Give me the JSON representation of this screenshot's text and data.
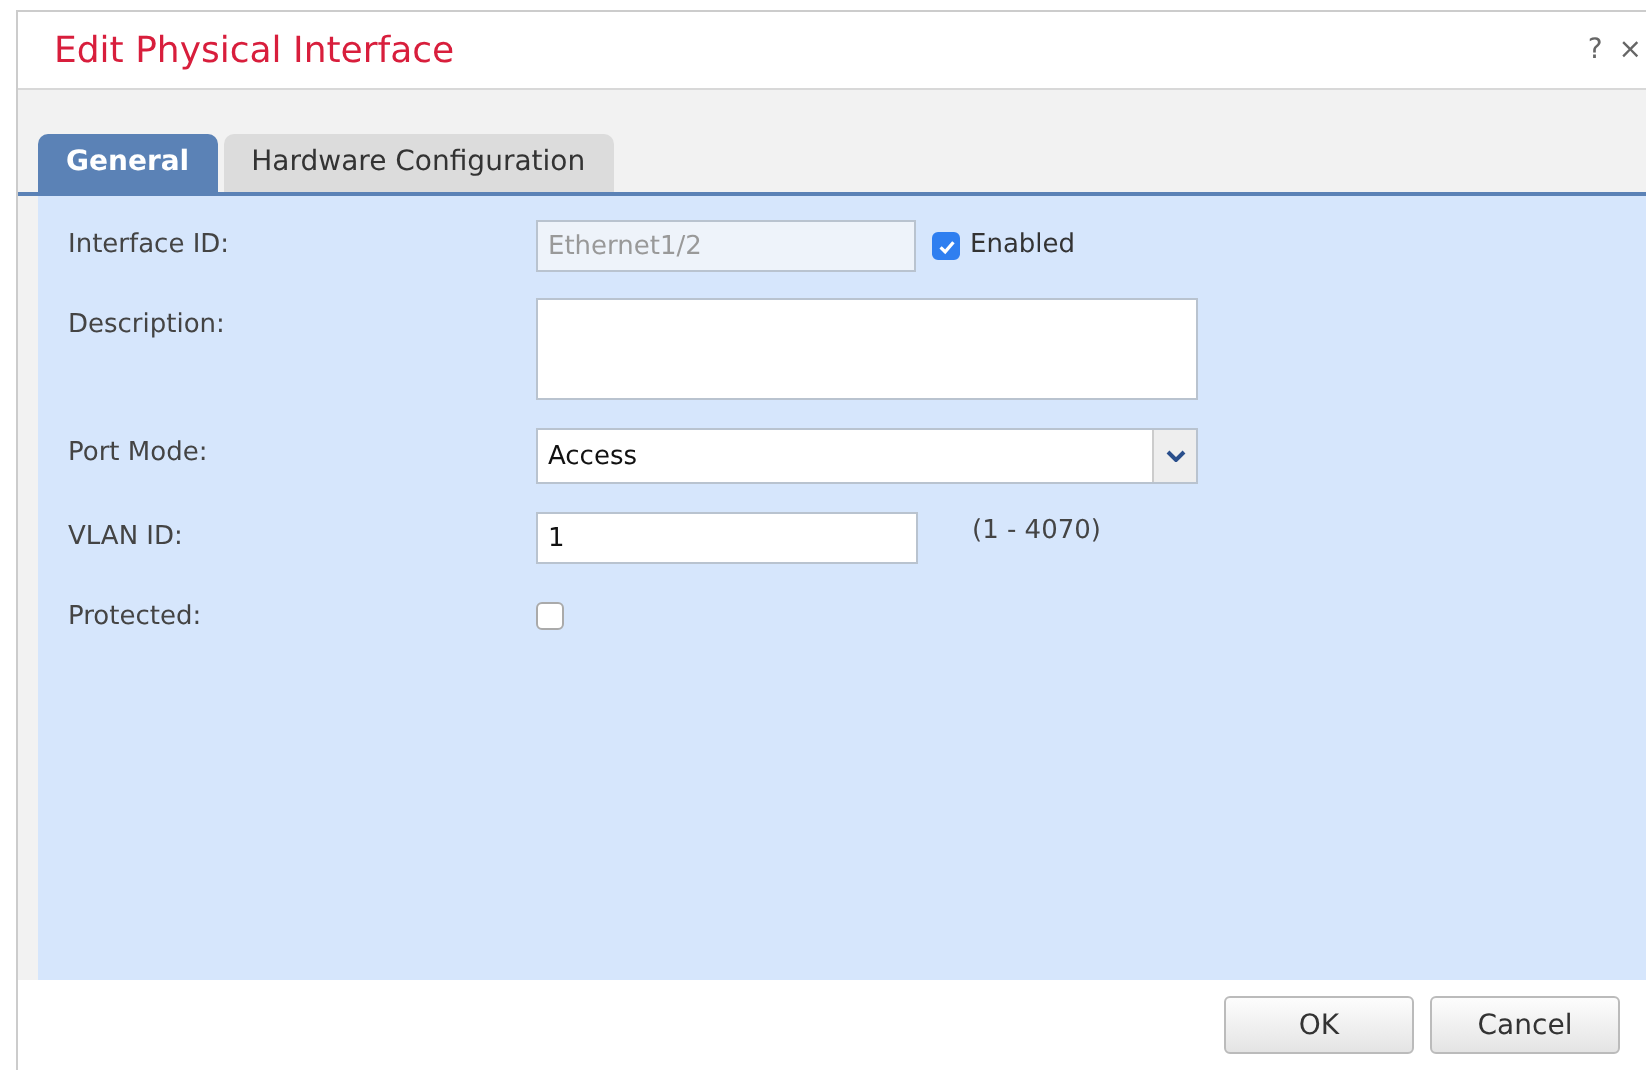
{
  "window": {
    "title": "Edit Physical Interface",
    "help": "?",
    "close": "×"
  },
  "tabs": [
    {
      "label": "General",
      "selected": true
    },
    {
      "label": "Hardware Configuration",
      "selected": false
    }
  ],
  "fields": [
    {
      "kind": "text",
      "label": "Interface ID:",
      "value": "Ethernet1/2",
      "disabled": true,
      "checkbox": {
        "label": "Enabled",
        "checked": true
      }
    },
    {
      "kind": "textarea",
      "label": "Description:"
    },
    {
      "kind": "select",
      "label": "Port Mode:",
      "value": "Access"
    },
    {
      "kind": "number",
      "label": "VLAN ID:",
      "value": "1",
      "hint": "(1 - 4070)"
    },
    {
      "kind": "checkbox",
      "label": "Protected:",
      "checked": false
    }
  ],
  "buttons": [
    "OK",
    "Cancel"
  ]
}
